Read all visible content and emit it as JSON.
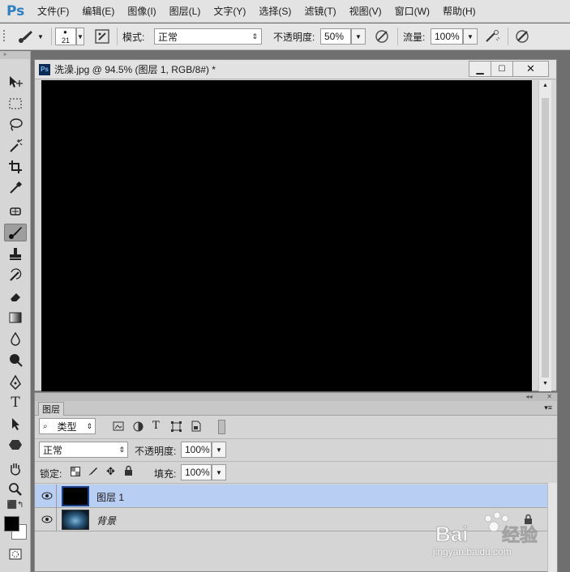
{
  "app": {
    "logo": "Ps"
  },
  "menu": [
    "文件(F)",
    "编辑(E)",
    "图像(I)",
    "图层(L)",
    "文字(Y)",
    "选择(S)",
    "滤镜(T)",
    "视图(V)",
    "窗口(W)",
    "帮助(H)"
  ],
  "options": {
    "brush_size": "21",
    "mode_label": "模式:",
    "mode_value": "正常",
    "opacity_label": "不透明度:",
    "opacity_value": "50%",
    "flow_label": "流量:",
    "flow_value": "100%"
  },
  "document": {
    "title": "洗澡.jpg @ 94.5% (图层 1, RGB/8#) *",
    "canvas_color": "#000000"
  },
  "layers_panel": {
    "tab_label": "图层",
    "filter_label": "类型",
    "blend_mode": "正常",
    "opacity_label": "不透明度:",
    "opacity_value": "100%",
    "lock_label": "锁定:",
    "fill_label": "填充:",
    "fill_value": "100%",
    "layers": [
      {
        "name": "图层 1",
        "selected": true
      },
      {
        "name": "背景",
        "selected": false
      }
    ]
  },
  "tools": [
    "move",
    "marquee",
    "lasso",
    "magic-wand",
    "crop",
    "eyedropper",
    "healing",
    "brush",
    "stamp",
    "history-brush",
    "eraser",
    "gradient",
    "blur",
    "dodge",
    "pen",
    "type",
    "path-select",
    "shape",
    "hand",
    "zoom"
  ],
  "watermark": {
    "text": "Bai 经验",
    "url": "jingyan.baidu.com"
  },
  "colors": {
    "selected_layer": "#b9cef3",
    "accent": "#2f7fc1"
  }
}
